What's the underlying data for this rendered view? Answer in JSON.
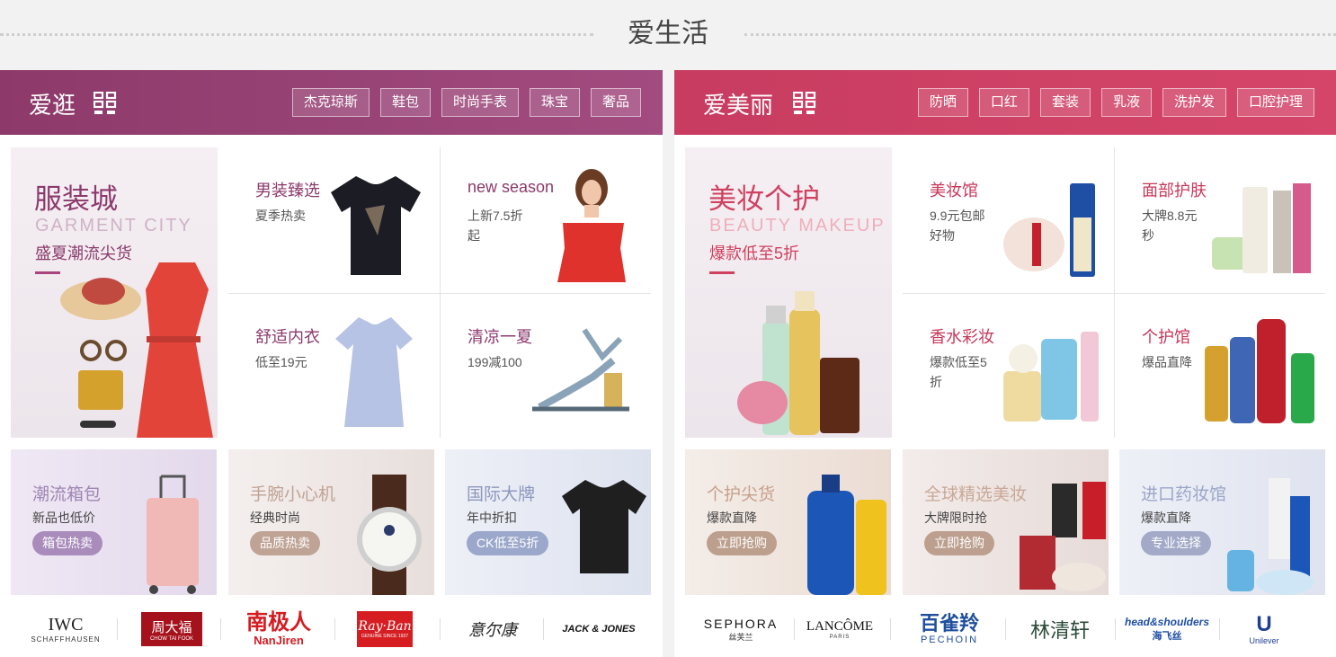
{
  "section_title": "爱生活",
  "left_panel": {
    "name": "爱逛",
    "tags": [
      "杰克琼斯",
      "鞋包",
      "时尚手表",
      "珠宝",
      "奢品"
    ],
    "hero": {
      "title": "服装城",
      "subtitle": "GARMENT CITY",
      "desc": "盛夏潮流尖货"
    },
    "cells": [
      {
        "title": "男装臻选",
        "desc": "夏季热卖"
      },
      {
        "title": "new season",
        "desc": "上新7.5折起"
      },
      {
        "title": "舒适内衣",
        "desc": "低至19元"
      },
      {
        "title": "清凉一夏",
        "desc": "199减100"
      }
    ],
    "promos": [
      {
        "title": "潮流箱包",
        "desc": "新品也低价",
        "button": "箱包热卖",
        "color": "#9d7fb0"
      },
      {
        "title": "手腕小心机",
        "desc": "经典时尚",
        "button": "品质热卖",
        "color": "#b89e8e"
      },
      {
        "title": "国际大牌",
        "desc": "年中折扣",
        "button": "CK低至5折",
        "color": "#98a4c6"
      }
    ],
    "logos": [
      {
        "text": "IWC",
        "sub": "SCHAFFHAUSEN"
      },
      {
        "text": "周大福",
        "sub": "CHOW TAI FOOK"
      },
      {
        "text": "南极人",
        "sub": "NanJiren"
      },
      {
        "text": "Ray·Ban",
        "sub": "GENUINE SINCE 1937"
      },
      {
        "text": "意尔康",
        "sub": ""
      },
      {
        "text": "JACK & JONES",
        "sub": ""
      }
    ]
  },
  "right_panel": {
    "name": "爱美丽",
    "tags": [
      "防晒",
      "口红",
      "套装",
      "乳液",
      "洗护发",
      "口腔护理"
    ],
    "hero": {
      "title": "美妆个护",
      "subtitle": "BEAUTY MAKEUP",
      "desc": "爆款低至5折"
    },
    "cells": [
      {
        "title": "美妆馆",
        "desc": "9.9元包邮好物"
      },
      {
        "title": "面部护肤",
        "desc": "大牌8.8元秒"
      },
      {
        "title": "香水彩妆",
        "desc": "爆款低至5折"
      },
      {
        "title": "个护馆",
        "desc": "爆品直降"
      }
    ],
    "promos": [
      {
        "title": "个护尖货",
        "desc": "爆款直降",
        "button": "立即抢购",
        "color": "#b99e8c"
      },
      {
        "title": "全球精选美妆",
        "desc": "大牌限时抢",
        "button": "立即抢购",
        "color": "#b99e8c"
      },
      {
        "title": "进口药妆馆",
        "desc": "爆款直降",
        "button": "专业选择",
        "color": "#a2aac8"
      }
    ],
    "logos": [
      {
        "text": "SEPHORA",
        "sub": "丝芙兰"
      },
      {
        "text": "LANCÔME",
        "sub": "PARIS"
      },
      {
        "text": "百雀羚",
        "sub": "PECHOIN"
      },
      {
        "text": "林清轩",
        "sub": ""
      },
      {
        "text": "head&shoulders",
        "sub": "海飞丝"
      },
      {
        "text": "U",
        "sub": "Unilever"
      }
    ]
  }
}
